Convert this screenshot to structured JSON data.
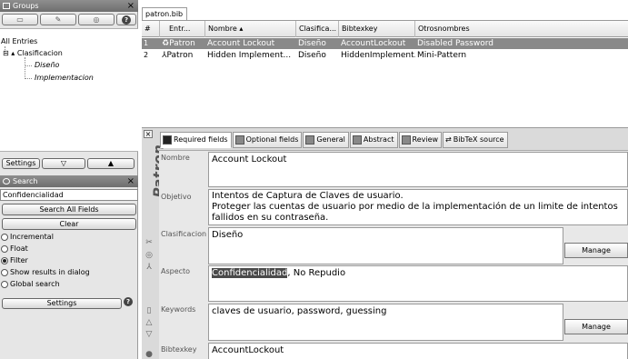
{
  "groups": {
    "title": "Groups",
    "close": "×",
    "tree": {
      "all": "All Entries",
      "parent": "Clasificacion",
      "children": [
        "Diseño",
        "Implementacion"
      ]
    },
    "settings_label": "Settings"
  },
  "search": {
    "title": "Search",
    "close": "×",
    "query": "Confidencialidad",
    "search_all_label": "Search All Fields",
    "clear_label": "Clear",
    "options": [
      "Incremental",
      "Float",
      "Filter",
      "Show results in dialog",
      "Global search"
    ],
    "selected": "Filter",
    "settings_label": "Settings"
  },
  "file_tab": "patron.bib",
  "table": {
    "headers": [
      "#",
      "Entr...",
      "Nombre ▴",
      "Clasifica...",
      "Bibtexkey",
      "Otrosnombres"
    ],
    "rows": [
      {
        "num": "1",
        "type": "Patron",
        "nombre": "Account Lockout",
        "clasificacion": "Diseño",
        "bibtexkey": "AccountLockout",
        "otros": "Disabled Password"
      },
      {
        "num": "2",
        "type": "Patron",
        "nombre": "Hidden Implement...",
        "clasificacion": "Diseño",
        "bibtexkey": "HiddenImplement...",
        "otros": "Mini-Pattern"
      }
    ]
  },
  "editor": {
    "entry_type": "Patron",
    "tabs": [
      "Required fields",
      "Optional fields",
      "General",
      "Abstract",
      "Review",
      "BibTeX source"
    ],
    "fields": {
      "nombre": {
        "label": "Nombre",
        "value": "Account Lockout"
      },
      "objetivo": {
        "label": "Objetivo",
        "lines": [
          "Intentos de Captura de Claves de usuario.",
          "Proteger las cuentas de usuario por medio de la implementación de un limite de intentos",
          "fallidos en su contraseña."
        ]
      },
      "clasificacion": {
        "label": "Clasificacion",
        "value": "Diseño"
      },
      "aspecto": {
        "label": "Aspecto",
        "highlight": "Confidencialidad",
        "rest": ", No Repudio"
      },
      "keywords": {
        "label": "Keywords",
        "value": "claves de usuario, password, guessing"
      },
      "bibtexkey": {
        "label": "Bibtexkey",
        "value": "AccountLockout"
      }
    },
    "manage_label": "Manage"
  },
  "icons": [
    "groups-icon",
    "close-icon",
    "new-group-icon",
    "edit-group-icon",
    "remove-group-icon",
    "help-icon",
    "search-icon",
    "arrow-down-icon",
    "arrow-up-icon",
    "tool-icon",
    "web-icon",
    "pdf-icon",
    "copy-icon",
    "up-icon",
    "down-icon"
  ]
}
